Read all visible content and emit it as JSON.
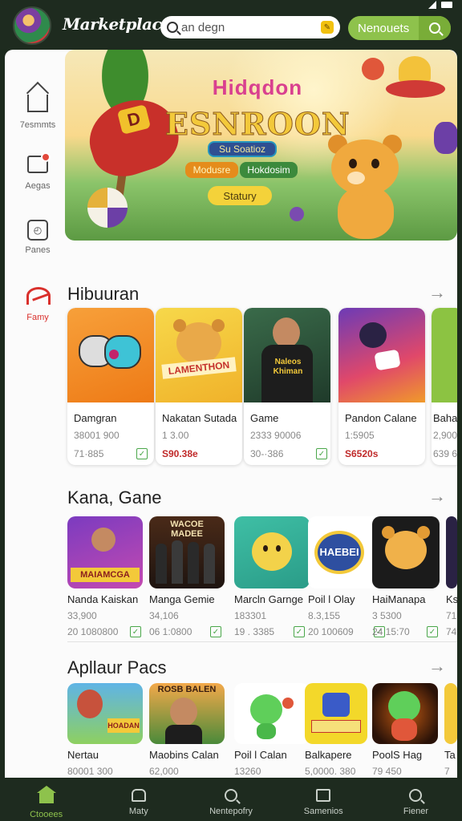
{
  "header": {
    "app_title": "Marketplace",
    "search_placeholder": "an degn",
    "notifications_label": "Nenouets"
  },
  "sidebar": {
    "items": [
      {
        "label": "7esmmts",
        "icon": "home-icon"
      },
      {
        "label": "Aegas",
        "icon": "chat-icon"
      },
      {
        "label": "Panes",
        "icon": "game-icon"
      },
      {
        "label": "Famy",
        "icon": "favorite-icon"
      }
    ]
  },
  "banner": {
    "title": "Hidqdon",
    "headline": "ESNROON",
    "pill_1": "Su Soatioz",
    "pill_2": "Modusre",
    "pill_3": "Hokdosim",
    "cta": "Statury"
  },
  "sections": [
    {
      "title": "Hibuuran",
      "cards": [
        {
          "name": "Damgran",
          "meta": "38001 900",
          "price": "71·885",
          "price_style": "gray",
          "checked": true
        },
        {
          "name": "Nakatan Sutada",
          "meta": "1 3.00",
          "price": "S90.38e",
          "price_style": "red",
          "checked": false
        },
        {
          "name": "Game",
          "meta": "2333  90006",
          "price": "30-·386",
          "price_style": "gray",
          "checked": true
        },
        {
          "name": "Pandon Calane",
          "meta": "1:5905",
          "price": "S6520s",
          "price_style": "red",
          "checked": false
        },
        {
          "name": "Baha",
          "meta": "2,900",
          "price": "639 6",
          "price_style": "gray",
          "checked": false
        }
      ]
    },
    {
      "title": "Kana, Gane",
      "tiles": [
        {
          "name": "Nanda Kaiskan",
          "meta": "33,900",
          "price": "20 1080800",
          "checked": true
        },
        {
          "name": "Manga Gemie",
          "meta": "34,106",
          "price": "06 1:0800",
          "checked": true
        },
        {
          "name": "Marcln Garnge",
          "meta": "183301",
          "price": "19 . 3385",
          "checked": true
        },
        {
          "name": "Poil l Olay",
          "meta": "8.3,155",
          "price": "20 100609",
          "checked": true
        },
        {
          "name": "HaiManapa",
          "meta": "3 5300",
          "price": "24 15:70",
          "checked": true
        },
        {
          "name": "Ks",
          "meta": "71",
          "price": "74",
          "checked": false
        }
      ]
    },
    {
      "title": "Apllaur Pacs",
      "tiles": [
        {
          "name": "Nertau",
          "meta": "80001 300"
        },
        {
          "name": "Maobins Calan",
          "meta": "62,000"
        },
        {
          "name": "Poil l Calan",
          "meta": "13260"
        },
        {
          "name": "Balkapere",
          "meta": "5,0000. 380"
        },
        {
          "name": "PoolS Hag",
          "meta": "79 450"
        },
        {
          "name": "Ta",
          "meta": "7"
        }
      ]
    }
  ],
  "thumb_texts": {
    "lamenthon": "LAMENTHON",
    "naleos": "Naleos\nKhiman",
    "macoe": "WACOE MADEE",
    "maiamcga": "MAIAMCGA",
    "haebe": "HAEBEI",
    "hoadan": "HOADAN",
    "rosb": "ROSB BALEN"
  },
  "bottom_nav": [
    {
      "label": "Ctooees",
      "icon": "home-icon",
      "active": true
    },
    {
      "label": "Maty",
      "icon": "store-icon",
      "active": false
    },
    {
      "label": "Nentepofry",
      "icon": "search-icon",
      "active": false
    },
    {
      "label": "Samenios",
      "icon": "box-icon",
      "active": false
    },
    {
      "label": "Fiener",
      "icon": "search-icon",
      "active": false
    }
  ],
  "colors": {
    "header_bg": "#1e2b1f",
    "accent_green": "#8ec24c",
    "favorite_red": "#d9302c",
    "price_red": "#c02a2a"
  }
}
